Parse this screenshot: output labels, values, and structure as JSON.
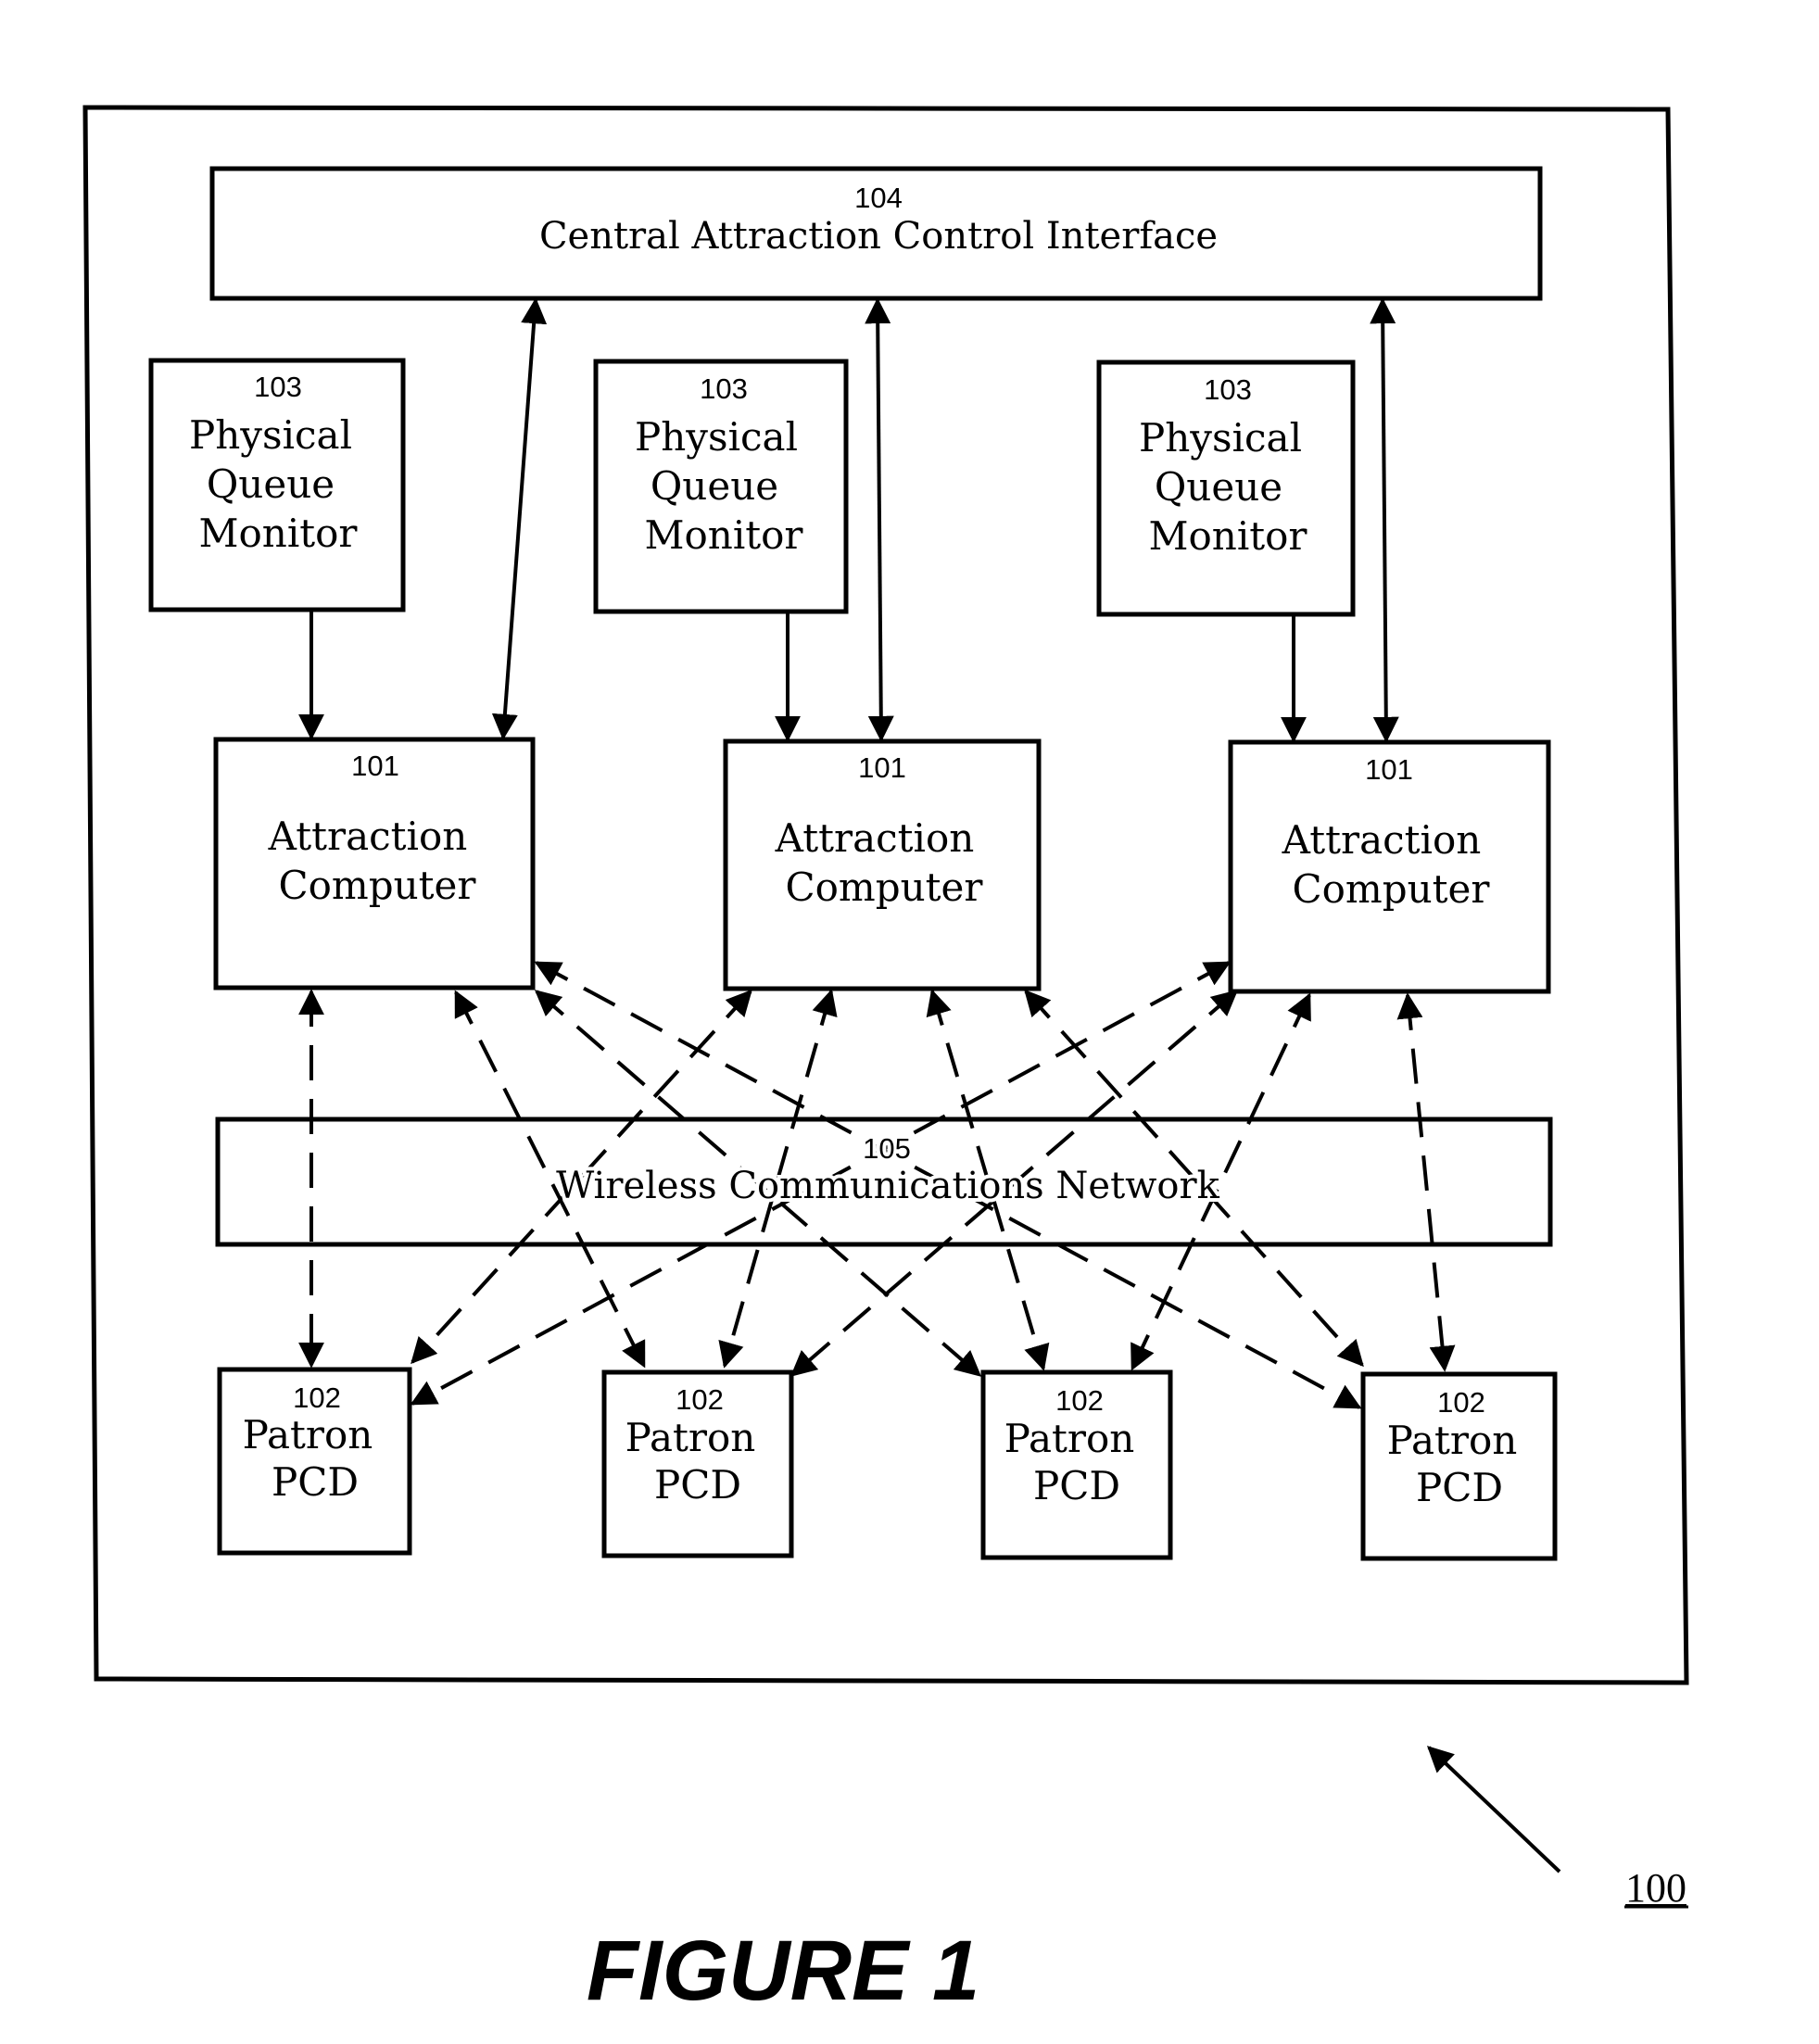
{
  "figure": {
    "caption": "FIGURE 1",
    "reference_numeral": "100"
  },
  "central_interface": {
    "number": "104",
    "label": "Central Attraction Control Interface"
  },
  "queue_monitors": [
    {
      "number": "103",
      "lines": [
        "Physical",
        "Queue",
        "Monitor"
      ]
    },
    {
      "number": "103",
      "lines": [
        "Physical",
        "Queue",
        "Monitor"
      ]
    },
    {
      "number": "103",
      "lines": [
        "Physical",
        "Queue",
        "Monitor"
      ]
    }
  ],
  "attraction_computers": [
    {
      "number": "101",
      "lines": [
        "Attraction",
        "Computer"
      ]
    },
    {
      "number": "101",
      "lines": [
        "Attraction",
        "Computer"
      ]
    },
    {
      "number": "101",
      "lines": [
        "Attraction",
        "Computer"
      ]
    }
  ],
  "network": {
    "number": "105",
    "label": "Wireless Communications Network"
  },
  "patron_pcds": [
    {
      "number": "102",
      "lines": [
        "Patron",
        "PCD"
      ]
    },
    {
      "number": "102",
      "lines": [
        "Patron",
        "PCD"
      ]
    },
    {
      "number": "102",
      "lines": [
        "Patron",
        "PCD"
      ]
    },
    {
      "number": "102",
      "lines": [
        "Patron",
        "PCD"
      ]
    }
  ],
  "connections": {
    "queue_monitor_to_attraction_computer": [
      {
        "from": "queue_monitor_1",
        "to": "attraction_computer_1",
        "style": "solid",
        "direction": "one-way"
      },
      {
        "from": "queue_monitor_2",
        "to": "attraction_computer_2",
        "style": "solid",
        "direction": "one-way"
      },
      {
        "from": "queue_monitor_3",
        "to": "attraction_computer_3",
        "style": "solid",
        "direction": "one-way"
      }
    ],
    "attraction_computer_to_central": [
      {
        "from": "attraction_computer_1",
        "to": "central_interface",
        "style": "solid",
        "direction": "two-way"
      },
      {
        "from": "attraction_computer_2",
        "to": "central_interface",
        "style": "solid",
        "direction": "two-way"
      },
      {
        "from": "attraction_computer_3",
        "to": "central_interface",
        "style": "solid",
        "direction": "two-way"
      }
    ],
    "attraction_computer_to_pcd_via_network": [
      {
        "from": "attraction_computer_1",
        "to": "patron_pcd_1",
        "style": "dashed",
        "direction": "two-way"
      },
      {
        "from": "attraction_computer_1",
        "to": "patron_pcd_2",
        "style": "dashed",
        "direction": "two-way"
      },
      {
        "from": "attraction_computer_1",
        "to": "patron_pcd_3",
        "style": "dashed",
        "direction": "two-way"
      },
      {
        "from": "attraction_computer_1",
        "to": "patron_pcd_4",
        "style": "dashed",
        "direction": "two-way"
      },
      {
        "from": "attraction_computer_2",
        "to": "patron_pcd_1",
        "style": "dashed",
        "direction": "two-way"
      },
      {
        "from": "attraction_computer_2",
        "to": "patron_pcd_2",
        "style": "dashed",
        "direction": "two-way"
      },
      {
        "from": "attraction_computer_2",
        "to": "patron_pcd_3",
        "style": "dashed",
        "direction": "two-way"
      },
      {
        "from": "attraction_computer_2",
        "to": "patron_pcd_4",
        "style": "dashed",
        "direction": "two-way"
      },
      {
        "from": "attraction_computer_3",
        "to": "patron_pcd_1",
        "style": "dashed",
        "direction": "two-way"
      },
      {
        "from": "attraction_computer_3",
        "to": "patron_pcd_2",
        "style": "dashed",
        "direction": "two-way"
      },
      {
        "from": "attraction_computer_3",
        "to": "patron_pcd_3",
        "style": "dashed",
        "direction": "two-way"
      },
      {
        "from": "attraction_computer_3",
        "to": "patron_pcd_4",
        "style": "dashed",
        "direction": "two-way"
      }
    ]
  },
  "colors": {
    "ink": "#000000",
    "paper": "#ffffff"
  }
}
